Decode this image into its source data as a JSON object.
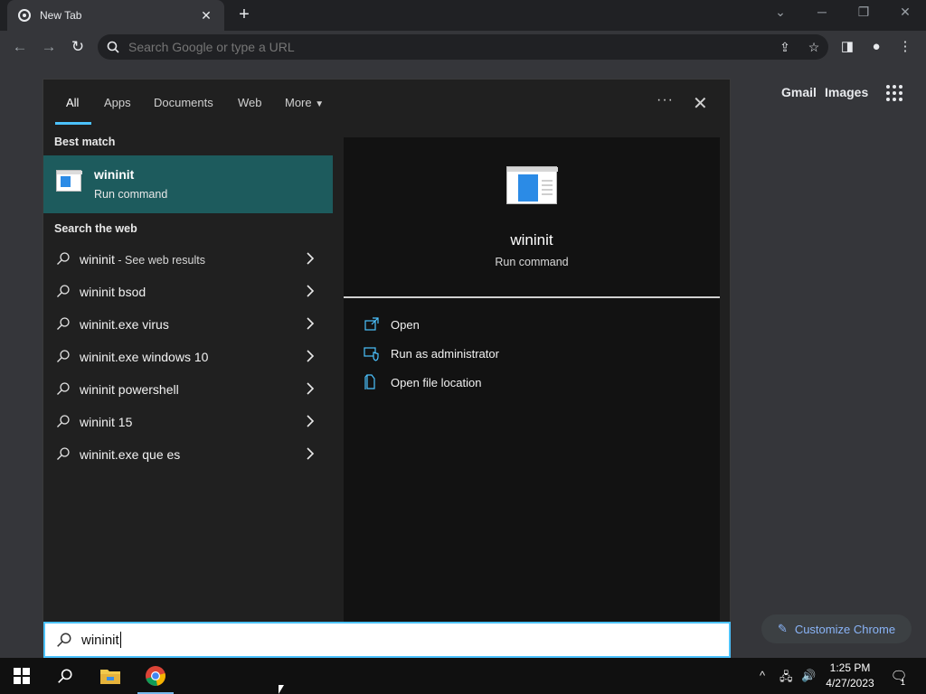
{
  "browser": {
    "tab_title": "New Tab",
    "omnibox_placeholder": "Search Google or type a URL",
    "gmail_label": "Gmail",
    "images_label": "Images",
    "customize_label": "Customize Chrome"
  },
  "search_panel": {
    "tabs": [
      "All",
      "Apps",
      "Documents",
      "Web",
      "More"
    ],
    "active_tab": "All",
    "more_icon": "ellipsis-icon",
    "close_icon": "close-icon",
    "best_match_header": "Best match",
    "best_match": {
      "title": "wininit",
      "subtitle": "Run command"
    },
    "web_header": "Search the web",
    "web_results": [
      {
        "text": "wininit",
        "suffix": " - See web results"
      },
      {
        "text": "wininit bsod",
        "suffix": ""
      },
      {
        "text": "wininit.exe virus",
        "suffix": ""
      },
      {
        "text": "wininit.exe windows 10",
        "suffix": ""
      },
      {
        "text": "wininit powershell",
        "suffix": ""
      },
      {
        "text": "wininit 15",
        "suffix": ""
      },
      {
        "text": "wininit.exe que es",
        "suffix": ""
      }
    ],
    "detail": {
      "title": "wininit",
      "subtitle": "Run command",
      "actions": [
        "Open",
        "Run as administrator",
        "Open file location"
      ]
    },
    "query": "wininit"
  },
  "taskbar": {
    "time": "1:25 PM",
    "date": "4/27/2023",
    "notification_count": "1"
  },
  "colors": {
    "accent": "#4cc2ff",
    "best_match_bg": "#1d5b5d",
    "link_blue": "#8ab4f8"
  }
}
